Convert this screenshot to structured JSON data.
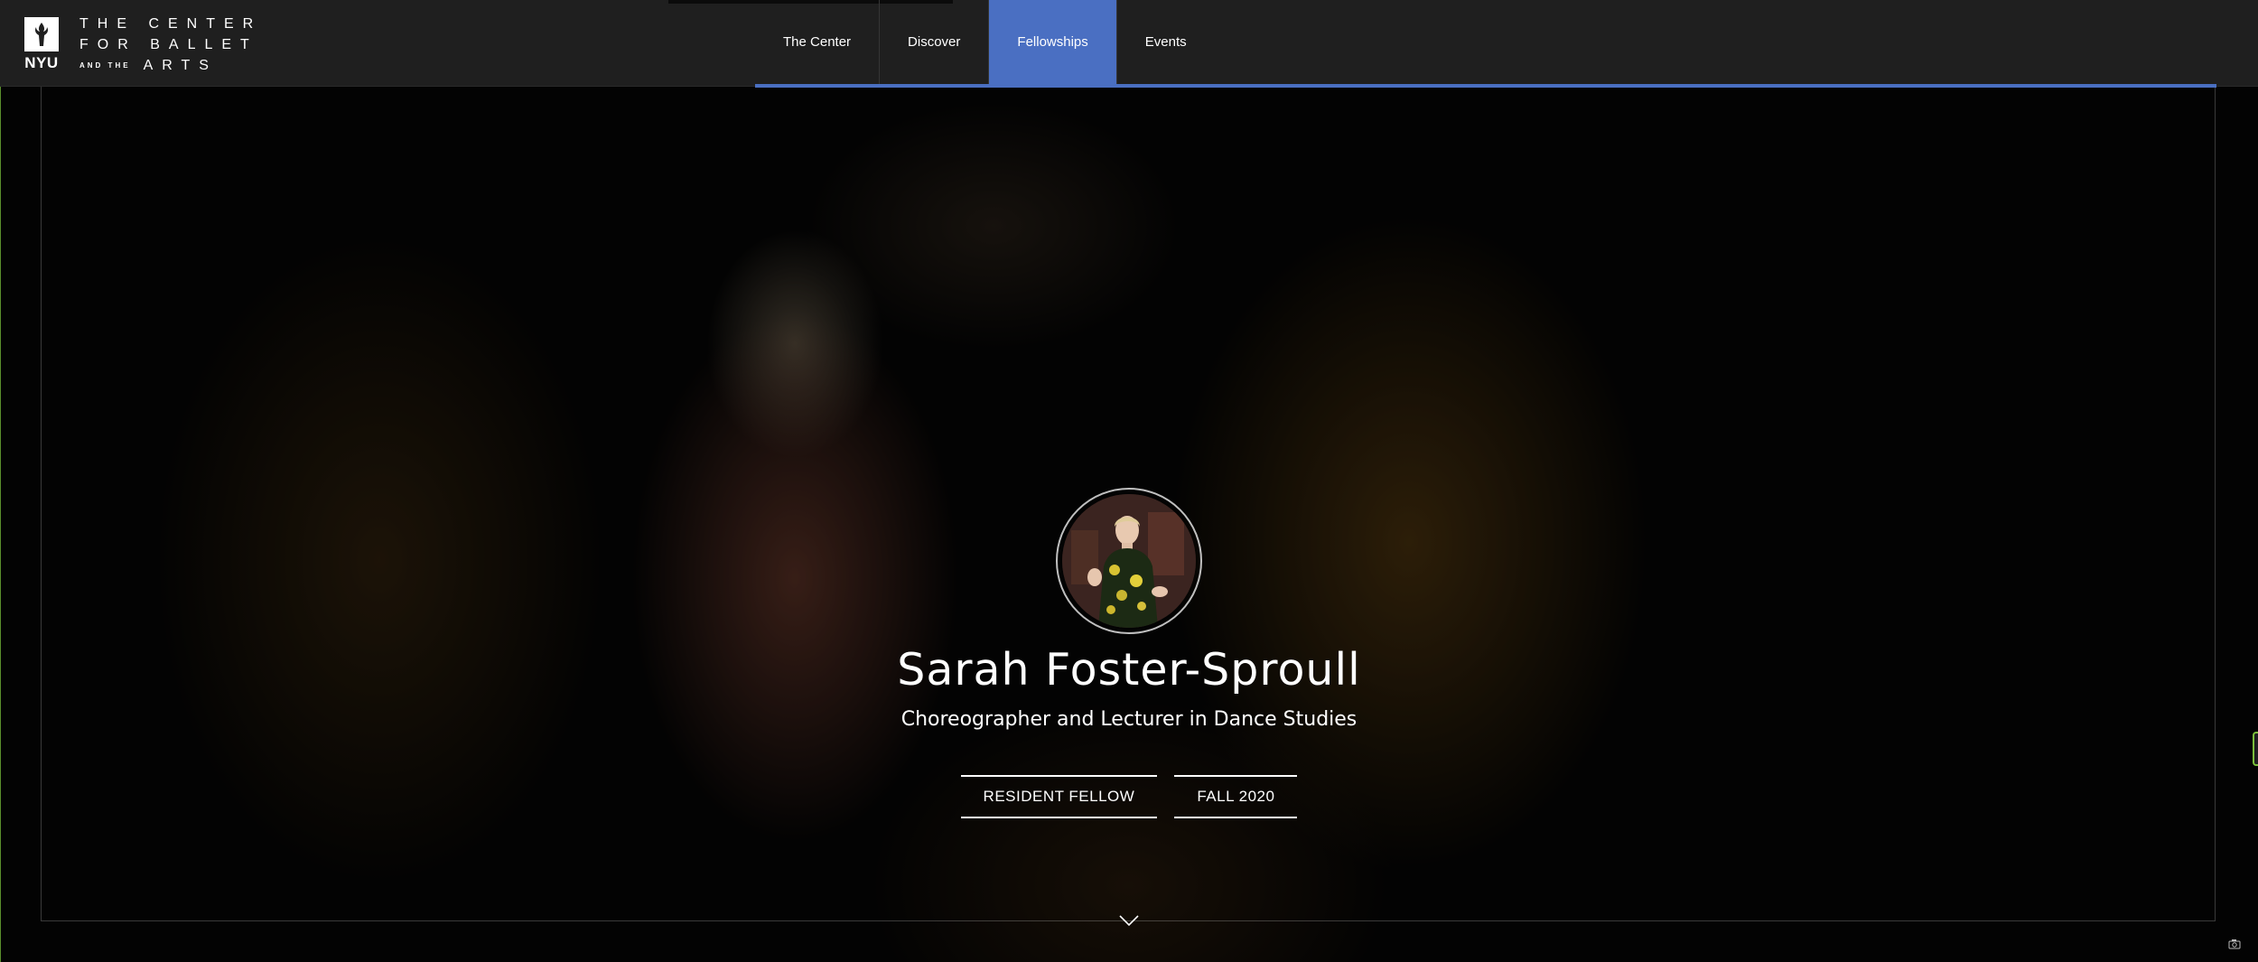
{
  "header": {
    "logo": {
      "nyu": "NYU",
      "line1": "THE CENTER",
      "line2": "FOR BALLET",
      "line3_small": "AND THE",
      "line3": "ARTS"
    },
    "nav": [
      {
        "label": "The Center"
      },
      {
        "label": "Discover"
      },
      {
        "label": "Fellowships"
      },
      {
        "label": "Events"
      }
    ],
    "active_nav": "Fellowships",
    "accent_color": "#4a6fc2"
  },
  "profile": {
    "name": "Sarah Foster-Sproull",
    "title": "Choreographer and Lecturer in Dance Studies",
    "badges": [
      {
        "label": "RESIDENT FELLOW"
      },
      {
        "label": "FALL 2020"
      }
    ]
  },
  "icons": {
    "scroll": "chevron-down-icon",
    "camera": "camera-icon"
  }
}
